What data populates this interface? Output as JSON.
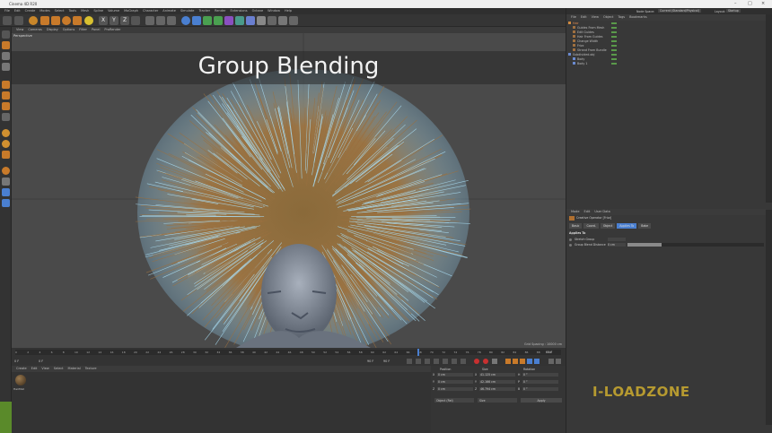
{
  "window": {
    "title": "Cinema 4D R20"
  },
  "menubar": [
    "File",
    "Edit",
    "Create",
    "Modes",
    "Select",
    "Tools",
    "Mesh",
    "Spline",
    "Volume",
    "MoGraph",
    "Character",
    "Animate",
    "Simulate",
    "Tracker",
    "Render",
    "Extensions",
    "Octane",
    "Window",
    "Help"
  ],
  "toolbar": {
    "axis_x": "X",
    "axis_y": "Y",
    "axis_z": "Z"
  },
  "viewport": {
    "menu": [
      "View",
      "Cameras",
      "Display",
      "Options",
      "Filter",
      "Panel",
      "ProRender"
    ],
    "label": "Perspective",
    "banner": "Group Blending",
    "grid_spacing": "Grid Spacing : 10000 cm"
  },
  "timeline": {
    "ticks": [
      "0",
      "2",
      "4",
      "6",
      "8",
      "10",
      "12",
      "14",
      "16",
      "18",
      "20",
      "22",
      "24",
      "26",
      "28",
      "30",
      "32",
      "34",
      "36",
      "38",
      "40",
      "42",
      "44",
      "46",
      "48",
      "50",
      "52",
      "54",
      "56",
      "58",
      "60",
      "62",
      "64",
      "66",
      "68",
      "70",
      "72",
      "74",
      "76",
      "78",
      "80",
      "82",
      "84",
      "86",
      "88",
      "90"
    ],
    "current_frame": "0 F",
    "start": "0 F",
    "end": "90 F",
    "end2": "90 F",
    "frame_right": "60 F"
  },
  "materials": {
    "menu": [
      "Create",
      "Edit",
      "View",
      "Select",
      "Material",
      "Texture"
    ],
    "item_label": "HairMat"
  },
  "coordinates": {
    "headers": [
      "Position",
      "Size",
      "Rotation"
    ],
    "rows": [
      {
        "axis": "X",
        "pos": "0 cm",
        "size": "41.125 cm",
        "rot_axis": "H",
        "rot": "0 °"
      },
      {
        "axis": "Y",
        "pos": "0 cm",
        "size": "42.166 cm",
        "rot_axis": "P",
        "rot": "0 °"
      },
      {
        "axis": "Z",
        "pos": "0 cm",
        "size": "46.794 cm",
        "rot_axis": "B",
        "rot": "0 °"
      }
    ],
    "mode": "Object (Rel)",
    "size_mode": "Size",
    "apply": "Apply"
  },
  "object_manager": {
    "top_right": {
      "node_space_label": "Node Space:",
      "node_space_value": "Current (Standard/Physical)",
      "layout_label": "Layout:",
      "layout_value": "Startup"
    },
    "menu": [
      "File",
      "Edit",
      "View",
      "Object",
      "Tags",
      "Bookmarks"
    ],
    "objects": [
      "Hair",
      "Guides From Mesh",
      "Edit Guides",
      "Hair From Guides",
      "Change Width",
      "Frizz",
      "Strand From Bundle",
      "Subdivided.obj",
      "Body",
      "Body 1"
    ]
  },
  "attributes": {
    "menu": [
      "Mode",
      "Edit",
      "User Data"
    ],
    "title": "Creative Operator [Frizz]",
    "tabs": [
      "Basic",
      "Coord.",
      "Object",
      "Applies To",
      "Bake"
    ],
    "section": "Applies To",
    "fields": [
      {
        "label": "Stretch Group",
        "value": ""
      },
      {
        "label": "Group Blend Distance",
        "value": "0 cm"
      }
    ],
    "blend_slider": 0.25
  },
  "watermark": "I-LOADZONE",
  "colors": {
    "accent": "#5a8fd0",
    "watermark": "#b69a30"
  }
}
